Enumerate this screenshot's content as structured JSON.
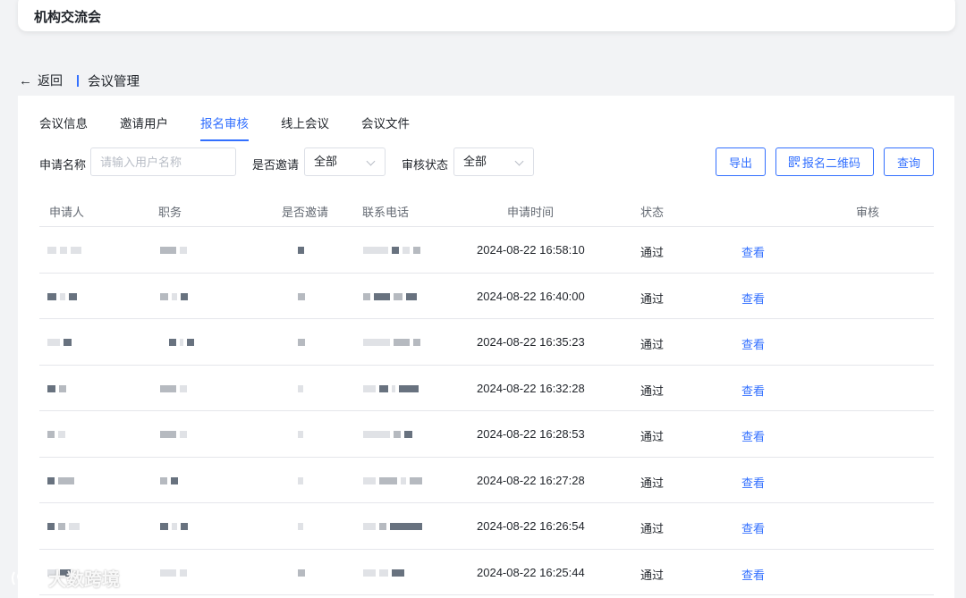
{
  "header": {
    "title": "机构交流会"
  },
  "breadcrumb": {
    "back_label": "返回",
    "current": "会议管理"
  },
  "tabs": [
    {
      "label": "会议信息",
      "active": false
    },
    {
      "label": "邀请用户",
      "active": false
    },
    {
      "label": "报名审核",
      "active": true
    },
    {
      "label": "线上会议",
      "active": false
    },
    {
      "label": "会议文件",
      "active": false
    }
  ],
  "filters": {
    "name_label": "申请名称",
    "name_placeholder": "请输入用户名称",
    "invite_label": "是否邀请",
    "invite_value": "全部",
    "status_label": "审核状态",
    "status_value": "全部",
    "export_label": "导出",
    "qrcode_label": "报名二维码",
    "query_label": "查询"
  },
  "table": {
    "columns": [
      "申请人",
      "职务",
      "是否邀请",
      "联系电话",
      "申请时间",
      "状态",
      "审核"
    ],
    "rows": [
      {
        "time": "2024-08-22 16:58:10",
        "status": "通过",
        "action": "查看"
      },
      {
        "time": "2024-08-22 16:40:00",
        "status": "通过",
        "action": "查看"
      },
      {
        "time": "2024-08-22 16:35:23",
        "status": "通过",
        "action": "查看"
      },
      {
        "time": "2024-08-22 16:32:28",
        "status": "通过",
        "action": "查看"
      },
      {
        "time": "2024-08-22 16:28:53",
        "status": "通过",
        "action": "查看"
      },
      {
        "time": "2024-08-22 16:27:28",
        "status": "通过",
        "action": "查看"
      },
      {
        "time": "2024-08-22 16:26:54",
        "status": "通过",
        "action": "查看"
      },
      {
        "time": "2024-08-22 16:25:44",
        "status": "通过",
        "action": "查看"
      }
    ]
  },
  "watermark": {
    "text": "大数跨境"
  },
  "colors": {
    "accent": "#3370ff",
    "background": "#f2f3f5"
  }
}
